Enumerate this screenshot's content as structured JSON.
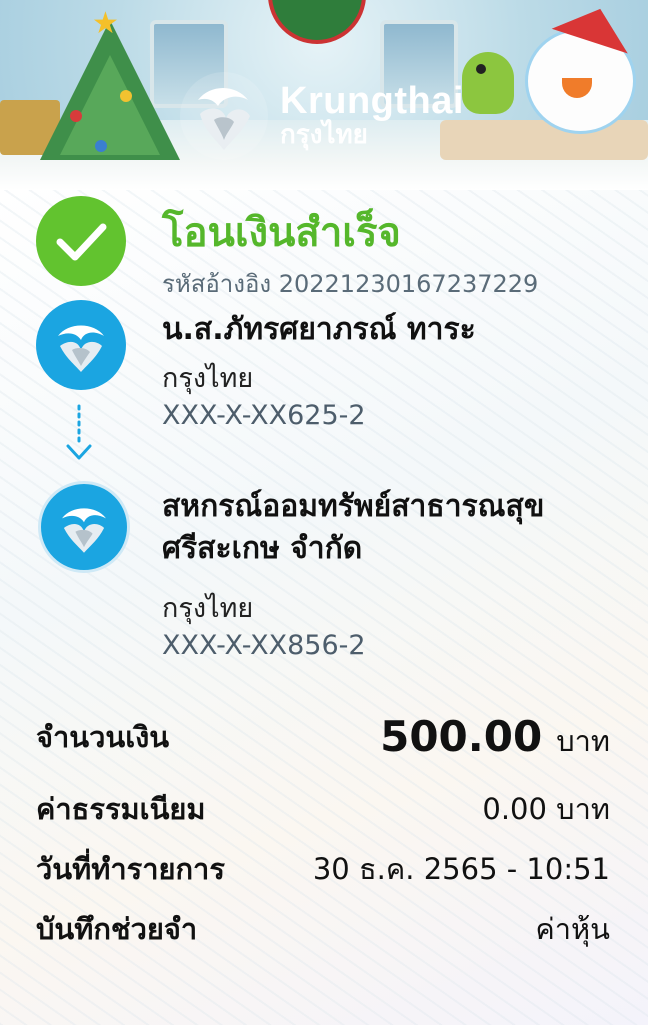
{
  "brand": {
    "name_en": "Krungthai",
    "name_th": "กรุงไทย"
  },
  "status": {
    "title": "โอนเงินสำเร็จ",
    "reference": "รหัสอ้างอิง 20221230167237229",
    "icon": "check-icon",
    "color": "#62c32f"
  },
  "sender": {
    "name": "น.ส.ภัทรศยาภรณ์ ทาระ",
    "bank": "กรุงไทย",
    "account": "XXX-X-XX625-2"
  },
  "receiver": {
    "name": "สหกรณ์ออมทรัพย์สาธารณสุขศรีสะเกษ จำกัด",
    "bank": "กรุงไทย",
    "account": "XXX-X-XX856-2"
  },
  "details": {
    "amount_label": "จำนวนเงิน",
    "amount_value": "500.00",
    "amount_unit": "บาท",
    "fee_label": "ค่าธรรมเนียม",
    "fee_value": "0.00 บาท",
    "date_label": "วันที่ทำรายการ",
    "date_value": "30 ธ.ค. 2565 - 10:51",
    "memo_label": "บันทึกช่วยจำ",
    "memo_value": "ค่าหุ้น"
  },
  "colors": {
    "accent_blue": "#1ba5e1",
    "success_green": "#55b72b"
  }
}
